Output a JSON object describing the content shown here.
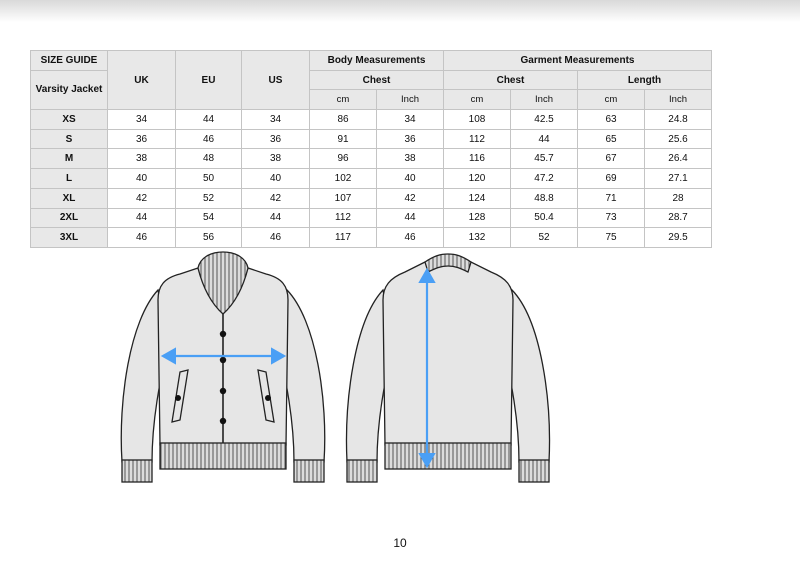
{
  "table": {
    "guide_label": "SIZE GUIDE",
    "product_label": "Varsity Jacket",
    "col_uk": "UK",
    "col_eu": "EU",
    "col_us": "US",
    "group_body": "Body Measurements",
    "group_garment": "Garment Measurements",
    "sub_chest": "Chest",
    "sub_length": "Length",
    "unit_cm": "cm",
    "unit_inch": "Inch",
    "rows": [
      {
        "size": "XS",
        "uk": "34",
        "eu": "44",
        "us": "34",
        "body_cm": "86",
        "body_in": "34",
        "gchest_cm": "108",
        "gchest_in": "42.5",
        "len_cm": "63",
        "len_in": "24.8"
      },
      {
        "size": "S",
        "uk": "36",
        "eu": "46",
        "us": "36",
        "body_cm": "91",
        "body_in": "36",
        "gchest_cm": "112",
        "gchest_in": "44",
        "len_cm": "65",
        "len_in": "25.6"
      },
      {
        "size": "M",
        "uk": "38",
        "eu": "48",
        "us": "38",
        "body_cm": "96",
        "body_in": "38",
        "gchest_cm": "116",
        "gchest_in": "45.7",
        "len_cm": "67",
        "len_in": "26.4"
      },
      {
        "size": "L",
        "uk": "40",
        "eu": "50",
        "us": "40",
        "body_cm": "102",
        "body_in": "40",
        "gchest_cm": "120",
        "gchest_in": "47.2",
        "len_cm": "69",
        "len_in": "27.1"
      },
      {
        "size": "XL",
        "uk": "42",
        "eu": "52",
        "us": "42",
        "body_cm": "107",
        "body_in": "42",
        "gchest_cm": "124",
        "gchest_in": "48.8",
        "len_cm": "71",
        "len_in": "28"
      },
      {
        "size": "2XL",
        "uk": "44",
        "eu": "54",
        "us": "44",
        "body_cm": "112",
        "body_in": "44",
        "gchest_cm": "128",
        "gchest_in": "50.4",
        "len_cm": "73",
        "len_in": "28.7"
      },
      {
        "size": "3XL",
        "uk": "46",
        "eu": "56",
        "us": "46",
        "body_cm": "117",
        "body_in": "46",
        "gchest_cm": "132",
        "gchest_in": "52",
        "len_cm": "75",
        "len_in": "29.5"
      }
    ]
  },
  "illustration": {
    "arrow_color": "#4a9ff5",
    "jacket_fill": "#e6e6e6",
    "rib_fill": "#dcdcdc"
  },
  "page_number": "10"
}
